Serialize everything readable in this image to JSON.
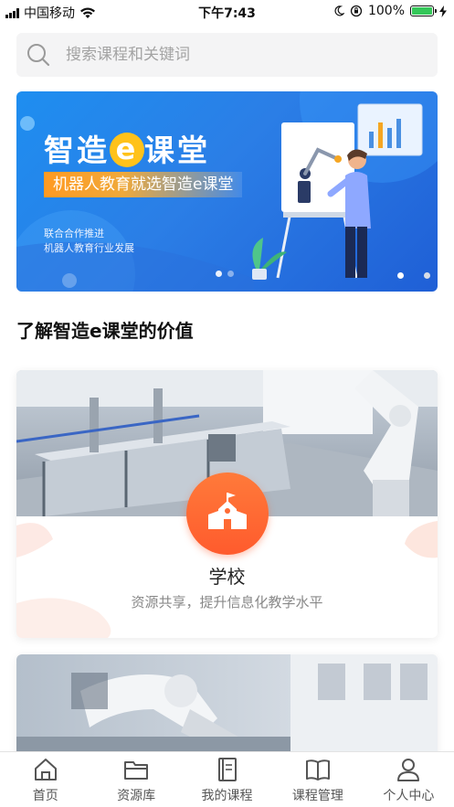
{
  "status_bar": {
    "carrier": "中国移动",
    "time": "下午7:43",
    "battery": "100%",
    "icons": [
      "signal-icon",
      "wifi-icon",
      "moon-icon",
      "orientation-lock-icon",
      "battery-icon",
      "charging-icon"
    ]
  },
  "search": {
    "placeholder": "搜索课程和关键词",
    "icon": "search-icon"
  },
  "banner": {
    "title_prefix": "智造",
    "title_e": "e",
    "title_suffix": "课堂",
    "subtitle": "机器人教育就选智造e课堂",
    "note_line1": "联合合作推进",
    "note_line2": "机器人教育行业发展"
  },
  "section": {
    "title": "了解智造e课堂的价值"
  },
  "cards": [
    {
      "name": "学校",
      "desc": "资源共享，提升信息化教学水平",
      "icon": "school-icon"
    }
  ],
  "tabbar": {
    "items": [
      {
        "label": "首页",
        "icon": "home-icon"
      },
      {
        "label": "资源库",
        "icon": "folder-icon"
      },
      {
        "label": "我的课程",
        "icon": "book-icon"
      },
      {
        "label": "课程管理",
        "icon": "open-book-icon"
      },
      {
        "label": "个人中心",
        "icon": "user-icon"
      }
    ]
  },
  "colors": {
    "accent": "#ff5b2d",
    "banner_blue": "#1f7ee8",
    "highlight_yellow": "#ffc21a"
  }
}
